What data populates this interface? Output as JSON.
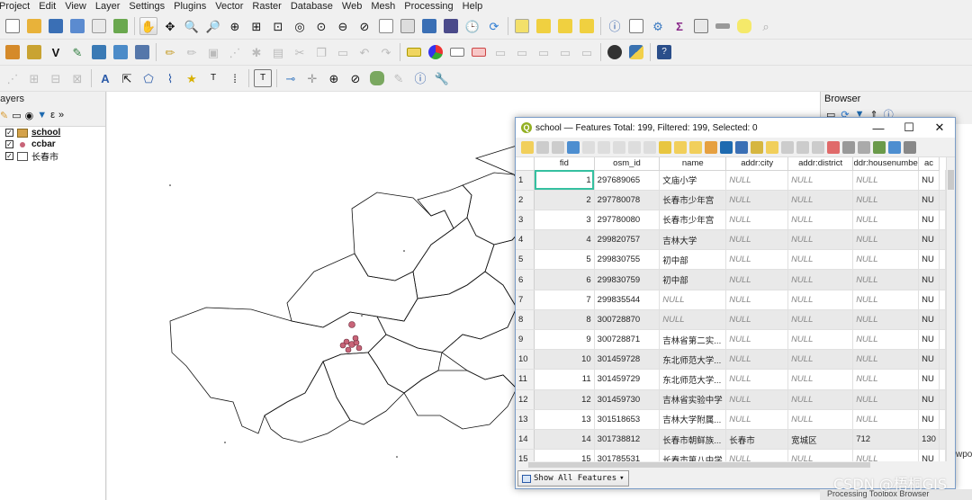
{
  "menu": [
    "Project",
    "Edit",
    "View",
    "Layer",
    "Settings",
    "Plugins",
    "Vector",
    "Raster",
    "Database",
    "Web",
    "Mesh",
    "Processing",
    "Help"
  ],
  "layers_panel": {
    "title": "Layers",
    "items": [
      {
        "name": "school",
        "checked": true,
        "symbol": "#d4a24a"
      },
      {
        "name": "ccbar",
        "checked": true,
        "symbol": "#c86478"
      },
      {
        "name": "长春市",
        "checked": true,
        "symbol": "#ffffff"
      }
    ]
  },
  "browser_panel": {
    "title": "Browser",
    "side_label": "wpo"
  },
  "attribute_table": {
    "title": "school — Features Total: 199, Filtered: 199, Selected: 0",
    "columns": [
      "fid",
      "osm_id",
      "name",
      "addr:city",
      "addr:district",
      "ddr:housenumbe",
      "ac"
    ],
    "rows": [
      {
        "n": "1",
        "fid": "1",
        "osm_id": "297689065",
        "name": "文庙小学",
        "city": "NULL",
        "district": "NULL",
        "house": "NULL",
        "ac": "NU"
      },
      {
        "n": "2",
        "fid": "2",
        "osm_id": "297780078",
        "name": "长春市少年宫",
        "city": "NULL",
        "district": "NULL",
        "house": "NULL",
        "ac": "NU"
      },
      {
        "n": "3",
        "fid": "3",
        "osm_id": "297780080",
        "name": "长春市少年宫",
        "city": "NULL",
        "district": "NULL",
        "house": "NULL",
        "ac": "NU"
      },
      {
        "n": "4",
        "fid": "4",
        "osm_id": "299820757",
        "name": "吉林大学",
        "city": "NULL",
        "district": "NULL",
        "house": "NULL",
        "ac": "NU"
      },
      {
        "n": "5",
        "fid": "5",
        "osm_id": "299830755",
        "name": "初中部",
        "city": "NULL",
        "district": "NULL",
        "house": "NULL",
        "ac": "NU"
      },
      {
        "n": "6",
        "fid": "6",
        "osm_id": "299830759",
        "name": "初中部",
        "city": "NULL",
        "district": "NULL",
        "house": "NULL",
        "ac": "NU"
      },
      {
        "n": "7",
        "fid": "7",
        "osm_id": "299835544",
        "name": "NULL",
        "city": "NULL",
        "district": "NULL",
        "house": "NULL",
        "ac": "NU"
      },
      {
        "n": "8",
        "fid": "8",
        "osm_id": "300728870",
        "name": "NULL",
        "city": "NULL",
        "district": "NULL",
        "house": "NULL",
        "ac": "NU"
      },
      {
        "n": "9",
        "fid": "9",
        "osm_id": "300728871",
        "name": "吉林省第二实...",
        "city": "NULL",
        "district": "NULL",
        "house": "NULL",
        "ac": "NU"
      },
      {
        "n": "10",
        "fid": "10",
        "osm_id": "301459728",
        "name": "东北师范大学...",
        "city": "NULL",
        "district": "NULL",
        "house": "NULL",
        "ac": "NU"
      },
      {
        "n": "11",
        "fid": "11",
        "osm_id": "301459729",
        "name": "东北师范大学...",
        "city": "NULL",
        "district": "NULL",
        "house": "NULL",
        "ac": "NU"
      },
      {
        "n": "12",
        "fid": "12",
        "osm_id": "301459730",
        "name": "吉林省实验中学",
        "city": "NULL",
        "district": "NULL",
        "house": "NULL",
        "ac": "NU"
      },
      {
        "n": "13",
        "fid": "13",
        "osm_id": "301518653",
        "name": "吉林大学附属...",
        "city": "NULL",
        "district": "NULL",
        "house": "NULL",
        "ac": "NU"
      },
      {
        "n": "14",
        "fid": "14",
        "osm_id": "301738812",
        "name": "长春市朝鲜族...",
        "city": "长春市",
        "district": "宽城区",
        "house": "712",
        "ac": "130"
      },
      {
        "n": "15",
        "fid": "15",
        "osm_id": "301785531",
        "name": "长春市第八中学",
        "city": "NULL",
        "district": "NULL",
        "house": "NULL",
        "ac": "NU"
      }
    ],
    "show_all_label": "Show All Features"
  },
  "watermark": "CSDN @梧桐GIS",
  "processing_toolbar": "Processing Toolbox  Browser"
}
